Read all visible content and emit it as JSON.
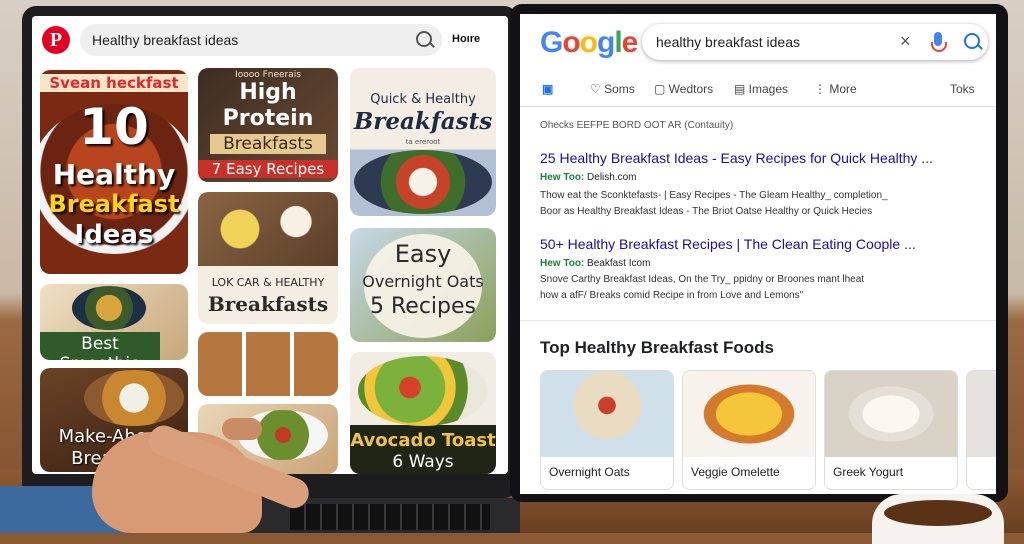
{
  "pinterest": {
    "logo": "P",
    "search_value": "Healthy breakfast ideas",
    "home_label": "Hoıre",
    "pins": {
      "p1": {
        "top": "Svean heckfast",
        "big": "10",
        "l2": "Healthy",
        "l3": "Breakfast",
        "l4": "Ideas"
      },
      "p2": {
        "top": "Ioooo Fneerais",
        "l1": "High",
        "l2": "Protein",
        "l3": "Breakfasts",
        "l4": "7 Easy Recipes"
      },
      "p3": {
        "l1": "Quick & Healthy",
        "l2": "Breakfasts",
        "l3": "ta ereroot"
      },
      "p4": {
        "l1": "Best Smoothie"
      },
      "p5": {
        "l1": "LOK CAR & HEALTHY",
        "l2": "Breakfasts"
      },
      "p6": {
        "l1": "Easy",
        "l2": "Overnight Oats",
        "l3": "5 Recipes"
      },
      "p7": {
        "l1": "Make-Ahead",
        "l2": "Breakfast"
      },
      "p8": {
        "l1": "Avocado Toast",
        "l2": "6 Ways"
      }
    }
  },
  "google": {
    "logo_letters": [
      "G",
      "o",
      "o",
      "g",
      "l",
      "e"
    ],
    "logo_colors": [
      "#4285f4",
      "#ea4335",
      "#fbbc05",
      "#4285f4",
      "#34a853",
      "#ea4335"
    ],
    "search_value": "healthy breakfast ideas",
    "clear_icon": "×",
    "tabs": {
      "all": "Soms",
      "videos": "Wedtors",
      "images": "Images",
      "more": "More",
      "tools": "Toks"
    },
    "meta": "Ohecks EEFPE BORD OOT AR (Contauity)",
    "results": [
      {
        "title": "25 Healthy Breakfast Ideas - Easy Recipes for Quick Healthy ...",
        "url_label": "Hew Too:",
        "url": "Delish.com",
        "snippet1": "Thow eat the Sconktefasts- | Easy Recipes - The Gleam Healthy_ completion_",
        "snippet2": "Boor as Healthy Breakfast Ideas - The Briot Oatse Healthy or Quick Hecies"
      },
      {
        "title": "50+ Healthy Breakfast Recipes | The Clean Eating Coople ...",
        "url_label": "Hew Too:",
        "url": "Beakfast Icom",
        "snippet1": "Snove Carthy Breakfast Ideas, On the Try_ ppidny or Broones mant lheat",
        "snippet2": "how a afF/ Breaks comid Recipe in from  Love and Lemons\""
      }
    ],
    "section_title": "Top Healthy Breakfast Foods",
    "cards": [
      "Overnight Oats",
      "Veggie Omelette",
      "Greek Yogurt"
    ]
  }
}
